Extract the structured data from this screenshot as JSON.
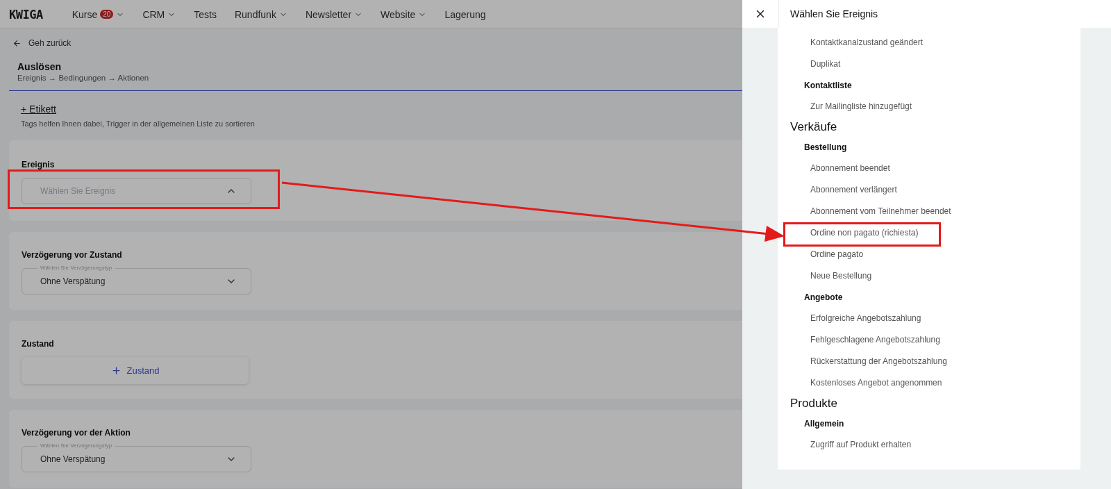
{
  "header": {
    "logo": "KWIGA",
    "nav": [
      {
        "label": "Kurse",
        "badge": "20",
        "dropdown": true
      },
      {
        "label": "CRM",
        "dropdown": true
      },
      {
        "label": "Tests",
        "dropdown": false
      },
      {
        "label": "Rundfunk",
        "dropdown": true
      },
      {
        "label": "Newsletter",
        "dropdown": true
      },
      {
        "label": "Website",
        "dropdown": true
      },
      {
        "label": "Lagerung",
        "dropdown": false
      }
    ]
  },
  "page": {
    "back": "Geh zurück",
    "title": "Auslösen",
    "steps": "Ereignis → Bedingungen → Aktionen",
    "tag_link": "+ Etikett",
    "tag_hint": "Tags helfen Ihnen dabei, Trigger in der allgemeinen Liste zu sortieren",
    "sections": [
      {
        "kind": "select",
        "title": "Ereignis",
        "placeholder": "Wählen Sie Ereignis",
        "expanded": true,
        "highlighted": true
      },
      {
        "kind": "select",
        "title": "Verzögerung vor Zustand",
        "label": "Wählen Sie Verzögerungstyp",
        "value": "Ohne Verspätung",
        "expanded": false,
        "highlighted": false
      },
      {
        "kind": "add",
        "title": "Zustand",
        "button": "Zustand"
      },
      {
        "kind": "select",
        "title": "Verzögerung vor der Aktion",
        "label": "Wählen Sie Verzögerungstyp",
        "value": "Ohne Verspätung",
        "expanded": false,
        "highlighted": false
      }
    ]
  },
  "drawer": {
    "title": "Wählen Sie Ereignis",
    "categories": [
      {
        "groups": [
          {
            "events": [
              {
                "label": "Kontaktkanalzustand geändert",
                "highlighted": false
              },
              {
                "label": "Duplikat",
                "highlighted": false
              }
            ]
          },
          {
            "name": "Kontaktliste",
            "events": [
              {
                "label": "Zur Mailingliste hinzugefügt",
                "highlighted": false
              }
            ]
          }
        ]
      },
      {
        "name": "Verkäufe",
        "groups": [
          {
            "name": "Bestellung",
            "events": [
              {
                "label": "Abonnement beendet",
                "highlighted": false
              },
              {
                "label": "Abonnement verlängert",
                "highlighted": false
              },
              {
                "label": "Abonnement vom Teilnehmer beendet",
                "highlighted": false
              },
              {
                "label": "Ordine non pagato (richiesta)",
                "highlighted": true
              },
              {
                "label": "Ordine pagato",
                "highlighted": false
              },
              {
                "label": "Neue Bestellung",
                "highlighted": false
              }
            ]
          },
          {
            "name": "Angebote",
            "events": [
              {
                "label": "Erfolgreiche Angebotszahlung",
                "highlighted": false
              },
              {
                "label": "Fehlgeschlagene Angebotszahlung",
                "highlighted": false
              },
              {
                "label": "Rückerstattung der Angebotszahlung",
                "highlighted": false
              },
              {
                "label": "Kostenloses Angebot angenommen",
                "highlighted": false
              }
            ]
          }
        ]
      },
      {
        "name": "Produkte",
        "groups": [
          {
            "name": "Allgemein",
            "events": [
              {
                "label": "Zugriff auf Produkt erhalten",
                "highlighted": false
              }
            ]
          }
        ]
      }
    ]
  }
}
